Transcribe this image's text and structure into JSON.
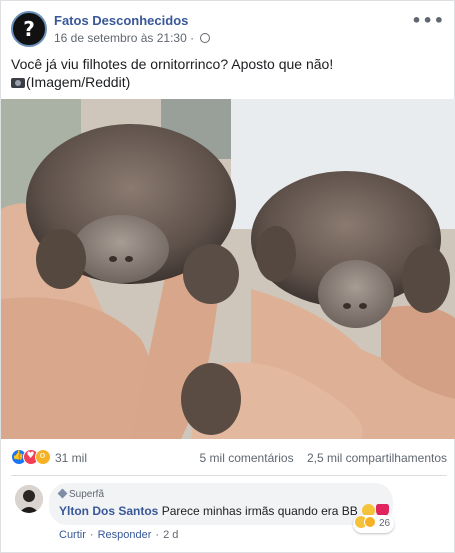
{
  "post": {
    "page_name": "Fatos Desconhecidos",
    "timestamp": "16 de setembro às 21:30",
    "privacy_icon": "globe-icon",
    "more_icon": "more-options-icon",
    "avatar_glyph": "?",
    "caption_line1": "Você já viu filhotes de ornitorrinco? Aposto que não!",
    "caption_line2": "(Imagem/Reddit)",
    "image_subject": "two baby platypuses held in hands"
  },
  "stats": {
    "reaction_icons": [
      "like-icon",
      "love-icon",
      "wow-icon"
    ],
    "reaction_count": "31 mil",
    "comments": "5 mil comentários",
    "shares": "2,5 mil compartilhamentos"
  },
  "comment": {
    "badge": "Superfã",
    "author": "Ylton Dos Santos",
    "text": "Parece minhas irmãs quando era BB",
    "reaction_count": "26",
    "like_label": "Curtir",
    "reply_label": "Responder",
    "age": "2 d"
  },
  "colors": {
    "link_blue": "#385898",
    "like_blue": "#1877f2",
    "love_red": "#f33e58",
    "wow_yellow": "#f7b125",
    "bubble_gray": "#f2f3f5"
  }
}
